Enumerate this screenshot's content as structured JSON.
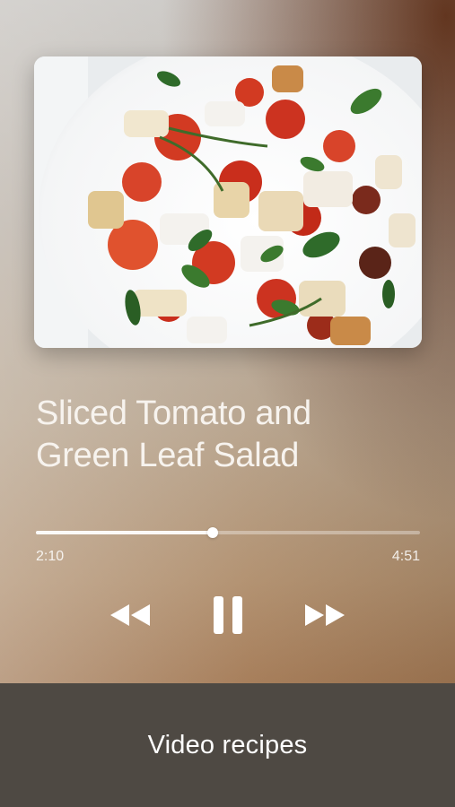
{
  "now_playing": {
    "title_line1": "Sliced Tomato and",
    "title_line2": "Green Leaf Salad",
    "elapsed": "2:10",
    "total": "4:51",
    "progress": 0.46
  },
  "controls": {
    "rewind_icon": "rewind-icon",
    "pause_icon": "pause-icon",
    "forward_icon": "fast-forward-icon"
  },
  "footer": {
    "label": "Video recipes"
  },
  "colors": {
    "accent_white": "#ffffff",
    "footer_bg": "#4e4943",
    "tomato_red": "#d8341f",
    "basil_green": "#2f6b2a"
  }
}
